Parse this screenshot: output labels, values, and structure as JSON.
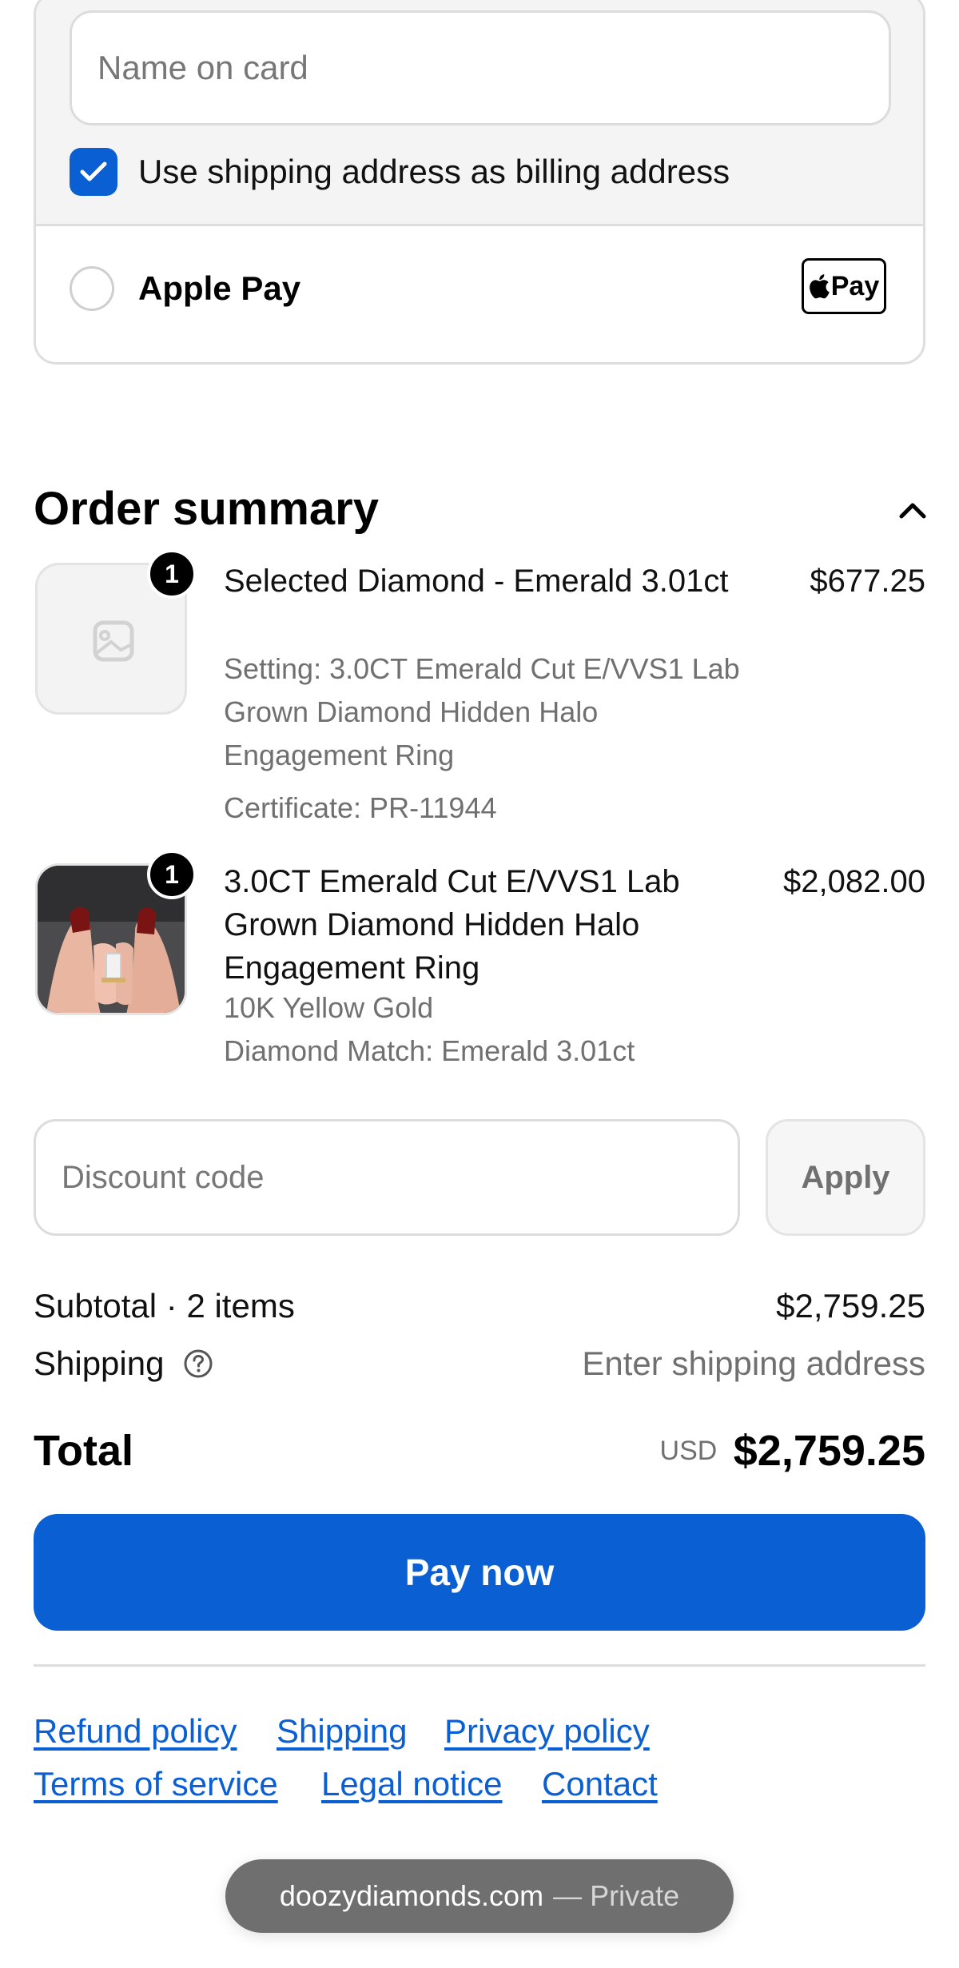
{
  "payment": {
    "name_placeholder": "Name on card",
    "billing_checkbox_label": "Use shipping address as billing address",
    "billing_checked": true,
    "apple_pay_label": "Apple Pay",
    "apple_pay_badge": "Pay"
  },
  "summary": {
    "title": "Order summary",
    "items": [
      {
        "quantity": "1",
        "title": "Selected Diamond - Emerald 3.01ct",
        "price": "$677.25",
        "details": [
          "Setting: 3.0CT Emerald Cut E/VVS1 Lab Grown Diamond Hidden Halo Engagement Ring",
          "Certificate: PR-11944"
        ],
        "image": "placeholder-image-icon"
      },
      {
        "quantity": "1",
        "title": "3.0CT Emerald Cut E/VVS1 Lab Grown Diamond Hidden Halo Engagement Ring",
        "price": "$2,082.00",
        "details": [
          "10K Yellow Gold",
          "Diamond Match: Emerald 3.01ct"
        ],
        "image": "ring-on-hand-photo"
      }
    ]
  },
  "discount": {
    "placeholder": "Discount code",
    "apply_label": "Apply"
  },
  "totals": {
    "subtotal_label": "Subtotal · 2 items",
    "subtotal_value": "$2,759.25",
    "shipping_label": "Shipping",
    "shipping_value": "Enter shipping address",
    "total_label": "Total",
    "currency": "USD",
    "total_value": "$2,759.25"
  },
  "pay_button": "Pay now",
  "footer": {
    "links": [
      "Refund policy",
      "Shipping",
      "Privacy policy",
      "Terms of service",
      "Legal notice",
      "Contact"
    ]
  },
  "browser": {
    "domain": "doozydiamonds.com",
    "mode": "— Private"
  },
  "colors": {
    "accent": "#0a5fd3",
    "muted_text": "#707070",
    "border": "#dedede"
  }
}
